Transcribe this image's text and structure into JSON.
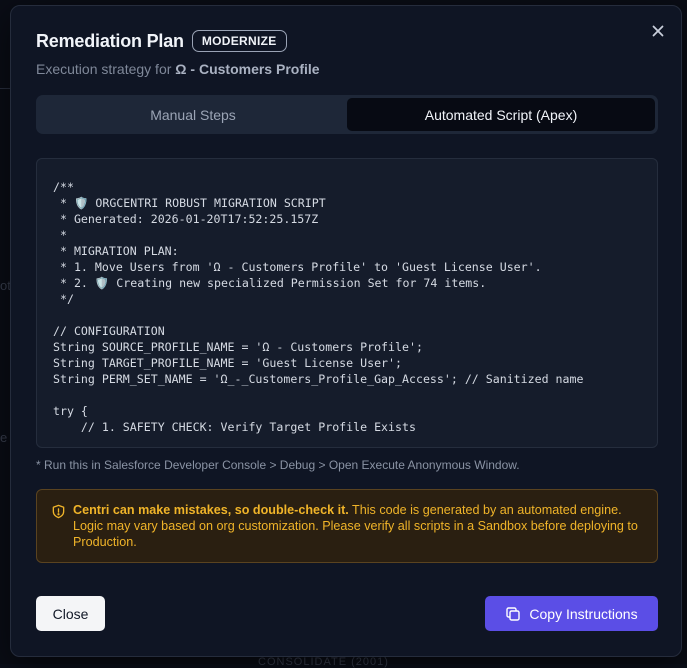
{
  "background": {
    "hint1": "ot",
    "hint2": "e",
    "hint3": "CONSOLIDATE (2001)"
  },
  "modal": {
    "title": "Remediation Plan",
    "badge": "MODERNIZE",
    "subtitle_prefix": "Execution strategy for ",
    "subtitle_target": "Ω - Customers Profile",
    "tabs": [
      {
        "label": "Manual Steps",
        "active": false
      },
      {
        "label": "Automated Script (Apex)",
        "active": true
      }
    ],
    "code": "/**\n * 🛡️ ORGCENTRI ROBUST MIGRATION SCRIPT\n * Generated: 2026-01-20T17:52:25.157Z\n *\n * MIGRATION PLAN:\n * 1. Move Users from 'Ω - Customers Profile' to 'Guest License User'.\n * 2. 🛡️ Creating new specialized Permission Set for 74 items.\n */\n\n// CONFIGURATION\nString SOURCE_PROFILE_NAME = 'Ω - Customers Profile';\nString TARGET_PROFILE_NAME = 'Guest License User';\nString PERM_SET_NAME = 'Ω_-_Customers_Profile_Gap_Access'; // Sanitized name\n\ntry {\n    // 1. SAFETY CHECK: Verify Target Profile Exists",
    "hint": "* Run this in Salesforce Developer Console > Debug > Open Execute Anonymous Window.",
    "warning_bold": "Centri can make mistakes, so double-check it.",
    "warning_text": " This code is generated by an automated engine. Logic may vary based on org customization. Please verify all scripts in a Sandbox before deploying to Production.",
    "close_label": "Close",
    "copy_label": "Copy Instructions"
  },
  "colors": {
    "accent": "#5b4ee6",
    "warning": "#f0b429",
    "surface": "#0f1524"
  },
  "icons": [
    "close-icon",
    "warning-shield-icon",
    "copy-icon"
  ]
}
